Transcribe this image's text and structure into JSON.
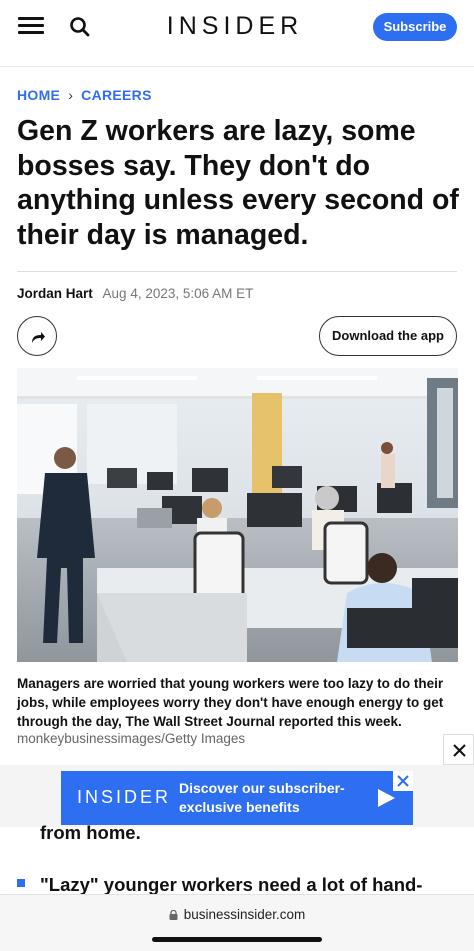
{
  "header": {
    "logo": "INSIDER",
    "subscribe_label": "Subscribe",
    "icons": [
      "menu-icon",
      "search-icon"
    ]
  },
  "breadcrumb": {
    "home": "HOME",
    "section": "CAREERS"
  },
  "article": {
    "headline": "Gen Z workers are lazy, some bosses say. They don't do anything unless every second of their day is managed.",
    "author": "Jordan Hart",
    "date": "Aug 4, 2023, 5:06 AM ET",
    "download_label": "Download the app",
    "caption": "Managers are worried that young workers were too lazy to do their jobs, while employees worry they don't have enough energy to get through the day, The Wall Street Journal reported this week.",
    "credit": "monkeybusinessimages/Getty Images",
    "body_fragment": "from home.",
    "bullet_text": "\"Lazy\" younger workers need a lot of hand-"
  },
  "ad": {
    "logo": "INSIDER",
    "text": "Discover our subscriber-exclusive benefits"
  },
  "browser": {
    "url": "businessinsider.com"
  },
  "colors": {
    "accent": "#2e6ff2",
    "text": "#111111",
    "muted": "#777777"
  }
}
